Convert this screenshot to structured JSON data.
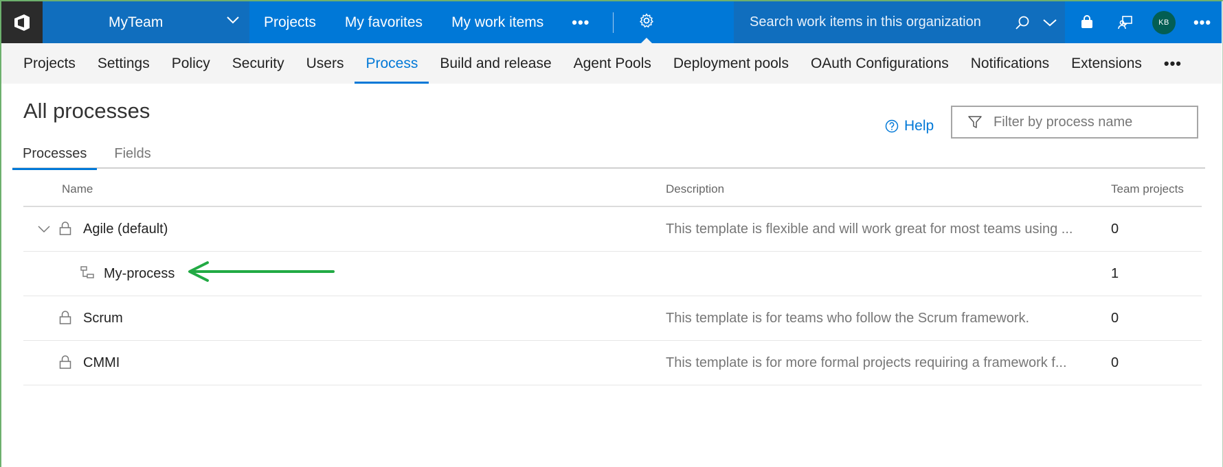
{
  "topbar": {
    "team_name": "MyTeam",
    "nav": [
      "Projects",
      "My favorites",
      "My work items"
    ],
    "more": "•••",
    "search_placeholder": "Search work items in this organization",
    "avatar_initials": "KB",
    "colors": {
      "bar": "#0078d7",
      "dark": "#106ebe",
      "logo_bg": "#2b2b2b",
      "avatar": "#035e53"
    },
    "icons": [
      "visual-studio-logo-icon",
      "chevron-down-icon",
      "gear-icon",
      "search-icon",
      "shopping-bag-icon",
      "feedback-person-icon",
      "more-icon"
    ]
  },
  "subnav": {
    "items": [
      "Projects",
      "Settings",
      "Policy",
      "Security",
      "Users",
      "Process",
      "Build and release",
      "Agent Pools",
      "Deployment pools",
      "OAuth Configurations",
      "Notifications",
      "Extensions"
    ],
    "active": "Process",
    "more": "•••"
  },
  "page": {
    "title": "All processes",
    "help_label": "Help",
    "filter_placeholder": "Filter by process name"
  },
  "tabs": {
    "items": [
      "Processes",
      "Fields"
    ],
    "active": "Processes"
  },
  "grid": {
    "columns": {
      "name": "Name",
      "description": "Description",
      "team_projects": "Team projects"
    },
    "rows": [
      {
        "name": "Agile (default)",
        "description": "This template is flexible and will work great for most teams using ...",
        "team_projects": "0",
        "expanded": true,
        "locked": true
      },
      {
        "name": "My-process",
        "description": "",
        "team_projects": "1",
        "inherited": true,
        "highlighted_by_arrow": true
      },
      {
        "name": "Scrum",
        "description": "This template is for teams who follow the Scrum framework.",
        "team_projects": "0",
        "locked": true
      },
      {
        "name": "CMMI",
        "description": "This template is for more formal projects requiring a framework f...",
        "team_projects": "0",
        "locked": true
      }
    ]
  },
  "annotation": {
    "arrow_color": "#22aa44"
  }
}
